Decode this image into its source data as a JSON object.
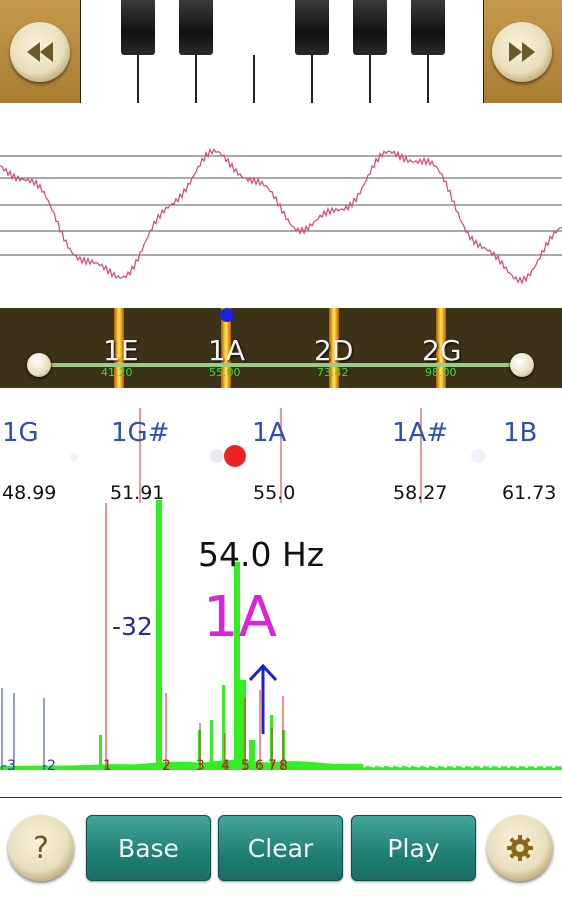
{
  "keyboard": {
    "prev_icon": "rewind-icon",
    "next_icon": "fast-forward-icon"
  },
  "tuning_strip": {
    "strings": [
      {
        "label": "1E",
        "freq": "41.20"
      },
      {
        "label": "1A",
        "freq": "55.00"
      },
      {
        "label": "2D",
        "freq": "73.42"
      },
      {
        "label": "2G",
        "freq": "98.00"
      }
    ]
  },
  "note_scale": {
    "notes": [
      {
        "name": "1G",
        "hz": "48.99"
      },
      {
        "name": "1G#",
        "hz": "51.91"
      },
      {
        "name": "1A",
        "hz": "55.0"
      },
      {
        "name": "1A#",
        "hz": "58.27"
      },
      {
        "name": "1B",
        "hz": "61.73"
      }
    ]
  },
  "readout": {
    "frequency": "54.0 Hz",
    "note": "1A",
    "cents": "-32"
  },
  "spectrum": {
    "harmonic_labels": [
      "-3",
      "-2",
      "1",
      "2",
      "3",
      "4",
      "5",
      "6",
      "7",
      "8"
    ]
  },
  "toolbar": {
    "help_label": "?",
    "base_label": "Base",
    "clear_label": "Clear",
    "play_label": "Play",
    "settings_icon": "gear-icon"
  },
  "colors": {
    "accent_teal": "#1f7f74",
    "note_blue": "#2f4fb5",
    "note_magenta": "#dd22dd",
    "spectrum_green": "#33ee22",
    "marker_red": "#dd2222",
    "wave_pink": "#e0407a"
  }
}
